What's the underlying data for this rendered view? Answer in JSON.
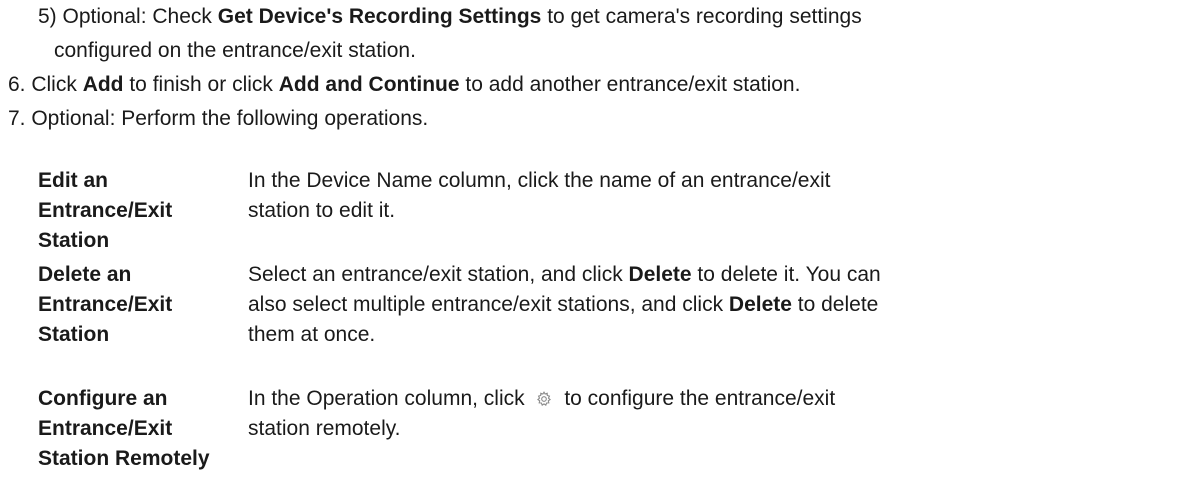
{
  "step5": {
    "prefix": "5) Optional: Check ",
    "bold": "Get Device's Recording Settings",
    "suffix": " to get camera's recording settings",
    "line2": "configured on the entrance/exit station."
  },
  "step6": {
    "prefix": "6. Click ",
    "bold1": "Add",
    "mid": " to finish or click ",
    "bold2": "Add and Continue",
    "suffix": " to add another entrance/exit station."
  },
  "step7": {
    "text": "7. Optional: Perform the following operations."
  },
  "operations": [
    {
      "name": "Edit an Entrance/Exit Station",
      "desc_line1": "In the Device Name column, click the name of an entrance/exit",
      "desc_line2": "station to edit it."
    },
    {
      "name": "Delete an Entrance/Exit Station",
      "desc_p1": "Select an entrance/exit station, and click ",
      "desc_b1": "Delete",
      "desc_p2": " to delete it. You can",
      "desc_p3": "also select multiple entrance/exit stations, and click ",
      "desc_b2": "Delete",
      "desc_p4": " to delete",
      "desc_p5": "them at once."
    },
    {
      "name": "Configure an Entrance/Exit Station Remotely",
      "desc_p1": "In the Operation column, click",
      "icon": "gear-icon",
      "desc_p2": "to configure the entrance/exit",
      "desc_p3": "station remotely."
    }
  ]
}
